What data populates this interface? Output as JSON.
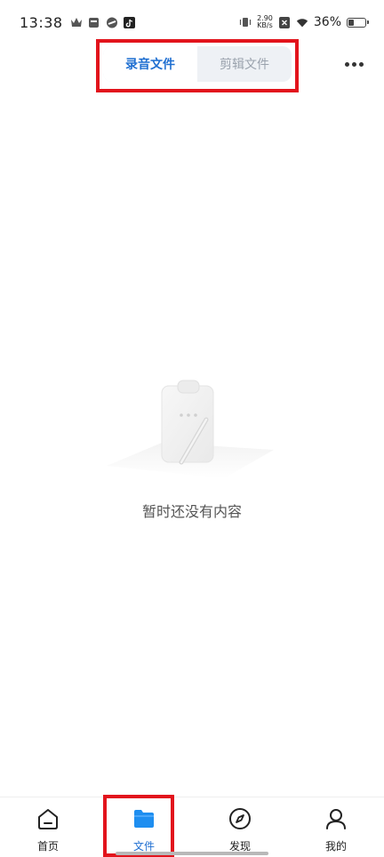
{
  "status_bar": {
    "time": "13:38",
    "speed_value": "2.90",
    "speed_unit": "KB/s",
    "battery_text": "36%",
    "battery_level": 0.36
  },
  "tabs": {
    "items": [
      {
        "label": "录音文件",
        "active": true
      },
      {
        "label": "剪辑文件",
        "active": false
      }
    ]
  },
  "header": {
    "more_icon": "more-horizontal-icon"
  },
  "empty_state": {
    "text": "暂时还没有内容",
    "icon": "empty-clipboard-illustration"
  },
  "bottom_nav": {
    "items": [
      {
        "label": "首页",
        "icon": "home-icon",
        "active": false
      },
      {
        "label": "文件",
        "icon": "folder-icon",
        "active": true
      },
      {
        "label": "发现",
        "icon": "compass-icon",
        "active": false
      },
      {
        "label": "我的",
        "icon": "user-icon",
        "active": false
      }
    ]
  },
  "colors": {
    "accent": "#1f6fd1",
    "highlight": "#e2141c"
  }
}
